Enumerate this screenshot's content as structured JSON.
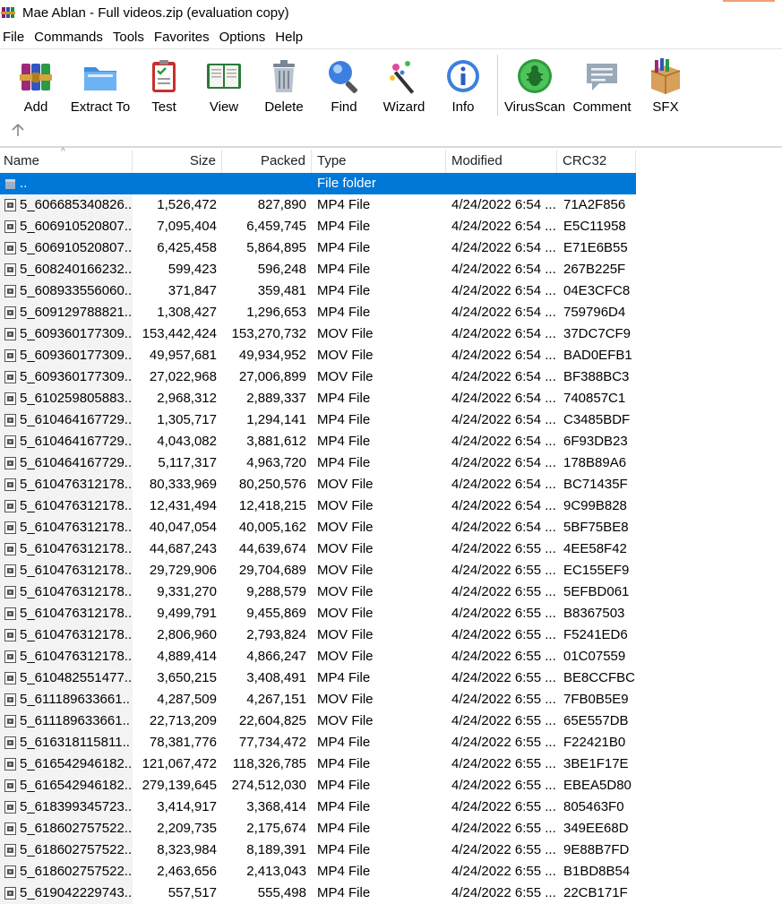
{
  "window": {
    "title": "Mae Ablan - Full videos.zip (evaluation copy)"
  },
  "menu": [
    "File",
    "Commands",
    "Tools",
    "Favorites",
    "Options",
    "Help"
  ],
  "toolbar": {
    "add": "Add",
    "extract": "Extract To",
    "test": "Test",
    "view": "View",
    "delete": "Delete",
    "find": "Find",
    "wizard": "Wizard",
    "info": "Info",
    "virusscan": "VirusScan",
    "comment": "Comment",
    "sfx": "SFX"
  },
  "columns": {
    "name": "Name",
    "size": "Size",
    "packed": "Packed",
    "type": "Type",
    "modified": "Modified",
    "crc": "CRC32"
  },
  "parent_row": {
    "name": "..",
    "type": "File folder"
  },
  "files": [
    {
      "name": "5_606685340826...",
      "size": "1,526,472",
      "packed": "827,890",
      "type": "MP4 File",
      "modified": "4/24/2022 6:54 ...",
      "crc": "71A2F856"
    },
    {
      "name": "5_606910520807...",
      "size": "7,095,404",
      "packed": "6,459,745",
      "type": "MP4 File",
      "modified": "4/24/2022 6:54 ...",
      "crc": "E5C11958"
    },
    {
      "name": "5_606910520807...",
      "size": "6,425,458",
      "packed": "5,864,895",
      "type": "MP4 File",
      "modified": "4/24/2022 6:54 ...",
      "crc": "E71E6B55"
    },
    {
      "name": "5_608240166232...",
      "size": "599,423",
      "packed": "596,248",
      "type": "MP4 File",
      "modified": "4/24/2022 6:54 ...",
      "crc": "267B225F"
    },
    {
      "name": "5_608933556060...",
      "size": "371,847",
      "packed": "359,481",
      "type": "MP4 File",
      "modified": "4/24/2022 6:54 ...",
      "crc": "04E3CFC8"
    },
    {
      "name": "5_609129788821...",
      "size": "1,308,427",
      "packed": "1,296,653",
      "type": "MP4 File",
      "modified": "4/24/2022 6:54 ...",
      "crc": "759796D4"
    },
    {
      "name": "5_609360177309...",
      "size": "153,442,424",
      "packed": "153,270,732",
      "type": "MOV File",
      "modified": "4/24/2022 6:54 ...",
      "crc": "37DC7CF9"
    },
    {
      "name": "5_609360177309...",
      "size": "49,957,681",
      "packed": "49,934,952",
      "type": "MOV File",
      "modified": "4/24/2022 6:54 ...",
      "crc": "BAD0EFB1"
    },
    {
      "name": "5_609360177309...",
      "size": "27,022,968",
      "packed": "27,006,899",
      "type": "MOV File",
      "modified": "4/24/2022 6:54 ...",
      "crc": "BF388BC3"
    },
    {
      "name": "5_610259805883...",
      "size": "2,968,312",
      "packed": "2,889,337",
      "type": "MP4 File",
      "modified": "4/24/2022 6:54 ...",
      "crc": "740857C1"
    },
    {
      "name": "5_610464167729...",
      "size": "1,305,717",
      "packed": "1,294,141",
      "type": "MP4 File",
      "modified": "4/24/2022 6:54 ...",
      "crc": "C3485BDF"
    },
    {
      "name": "5_610464167729...",
      "size": "4,043,082",
      "packed": "3,881,612",
      "type": "MP4 File",
      "modified": "4/24/2022 6:54 ...",
      "crc": "6F93DB23"
    },
    {
      "name": "5_610464167729...",
      "size": "5,117,317",
      "packed": "4,963,720",
      "type": "MP4 File",
      "modified": "4/24/2022 6:54 ...",
      "crc": "178B89A6"
    },
    {
      "name": "5_610476312178...",
      "size": "80,333,969",
      "packed": "80,250,576",
      "type": "MOV File",
      "modified": "4/24/2022 6:54 ...",
      "crc": "BC71435F"
    },
    {
      "name": "5_610476312178...",
      "size": "12,431,494",
      "packed": "12,418,215",
      "type": "MOV File",
      "modified": "4/24/2022 6:54 ...",
      "crc": "9C99B828"
    },
    {
      "name": "5_610476312178...",
      "size": "40,047,054",
      "packed": "40,005,162",
      "type": "MOV File",
      "modified": "4/24/2022 6:54 ...",
      "crc": "5BF75BE8"
    },
    {
      "name": "5_610476312178...",
      "size": "44,687,243",
      "packed": "44,639,674",
      "type": "MOV File",
      "modified": "4/24/2022 6:55 ...",
      "crc": "4EE58F42"
    },
    {
      "name": "5_610476312178...",
      "size": "29,729,906",
      "packed": "29,704,689",
      "type": "MOV File",
      "modified": "4/24/2022 6:55 ...",
      "crc": "EC155EF9"
    },
    {
      "name": "5_610476312178...",
      "size": "9,331,270",
      "packed": "9,288,579",
      "type": "MOV File",
      "modified": "4/24/2022 6:55 ...",
      "crc": "5EFBD061"
    },
    {
      "name": "5_610476312178...",
      "size": "9,499,791",
      "packed": "9,455,869",
      "type": "MOV File",
      "modified": "4/24/2022 6:55 ...",
      "crc": "B8367503"
    },
    {
      "name": "5_610476312178...",
      "size": "2,806,960",
      "packed": "2,793,824",
      "type": "MOV File",
      "modified": "4/24/2022 6:55 ...",
      "crc": "F5241ED6"
    },
    {
      "name": "5_610476312178...",
      "size": "4,889,414",
      "packed": "4,866,247",
      "type": "MOV File",
      "modified": "4/24/2022 6:55 ...",
      "crc": "01C07559"
    },
    {
      "name": "5_610482551477...",
      "size": "3,650,215",
      "packed": "3,408,491",
      "type": "MP4 File",
      "modified": "4/24/2022 6:55 ...",
      "crc": "BE8CCFBC"
    },
    {
      "name": "5_611189633661...",
      "size": "4,287,509",
      "packed": "4,267,151",
      "type": "MOV File",
      "modified": "4/24/2022 6:55 ...",
      "crc": "7FB0B5E9"
    },
    {
      "name": "5_611189633661...",
      "size": "22,713,209",
      "packed": "22,604,825",
      "type": "MOV File",
      "modified": "4/24/2022 6:55 ...",
      "crc": "65E557DB"
    },
    {
      "name": "5_616318115811...",
      "size": "78,381,776",
      "packed": "77,734,472",
      "type": "MP4 File",
      "modified": "4/24/2022 6:55 ...",
      "crc": "F22421B0"
    },
    {
      "name": "5_616542946182...",
      "size": "121,067,472",
      "packed": "118,326,785",
      "type": "MP4 File",
      "modified": "4/24/2022 6:55 ...",
      "crc": "3BE1F17E"
    },
    {
      "name": "5_616542946182...",
      "size": "279,139,645",
      "packed": "274,512,030",
      "type": "MP4 File",
      "modified": "4/24/2022 6:55 ...",
      "crc": "EBEA5D80"
    },
    {
      "name": "5_618399345723...",
      "size": "3,414,917",
      "packed": "3,368,414",
      "type": "MP4 File",
      "modified": "4/24/2022 6:55 ...",
      "crc": "805463F0"
    },
    {
      "name": "5_618602757522...",
      "size": "2,209,735",
      "packed": "2,175,674",
      "type": "MP4 File",
      "modified": "4/24/2022 6:55 ...",
      "crc": "349EE68D"
    },
    {
      "name": "5_618602757522...",
      "size": "8,323,984",
      "packed": "8,189,391",
      "type": "MP4 File",
      "modified": "4/24/2022 6:55 ...",
      "crc": "9E88B7FD"
    },
    {
      "name": "5_618602757522...",
      "size": "2,463,656",
      "packed": "2,413,043",
      "type": "MP4 File",
      "modified": "4/24/2022 6:55 ...",
      "crc": "B1BD8B54"
    },
    {
      "name": "5_619042229743...",
      "size": "557,517",
      "packed": "555,498",
      "type": "MP4 File",
      "modified": "4/24/2022 6:55 ...",
      "crc": "22CB171F"
    }
  ]
}
